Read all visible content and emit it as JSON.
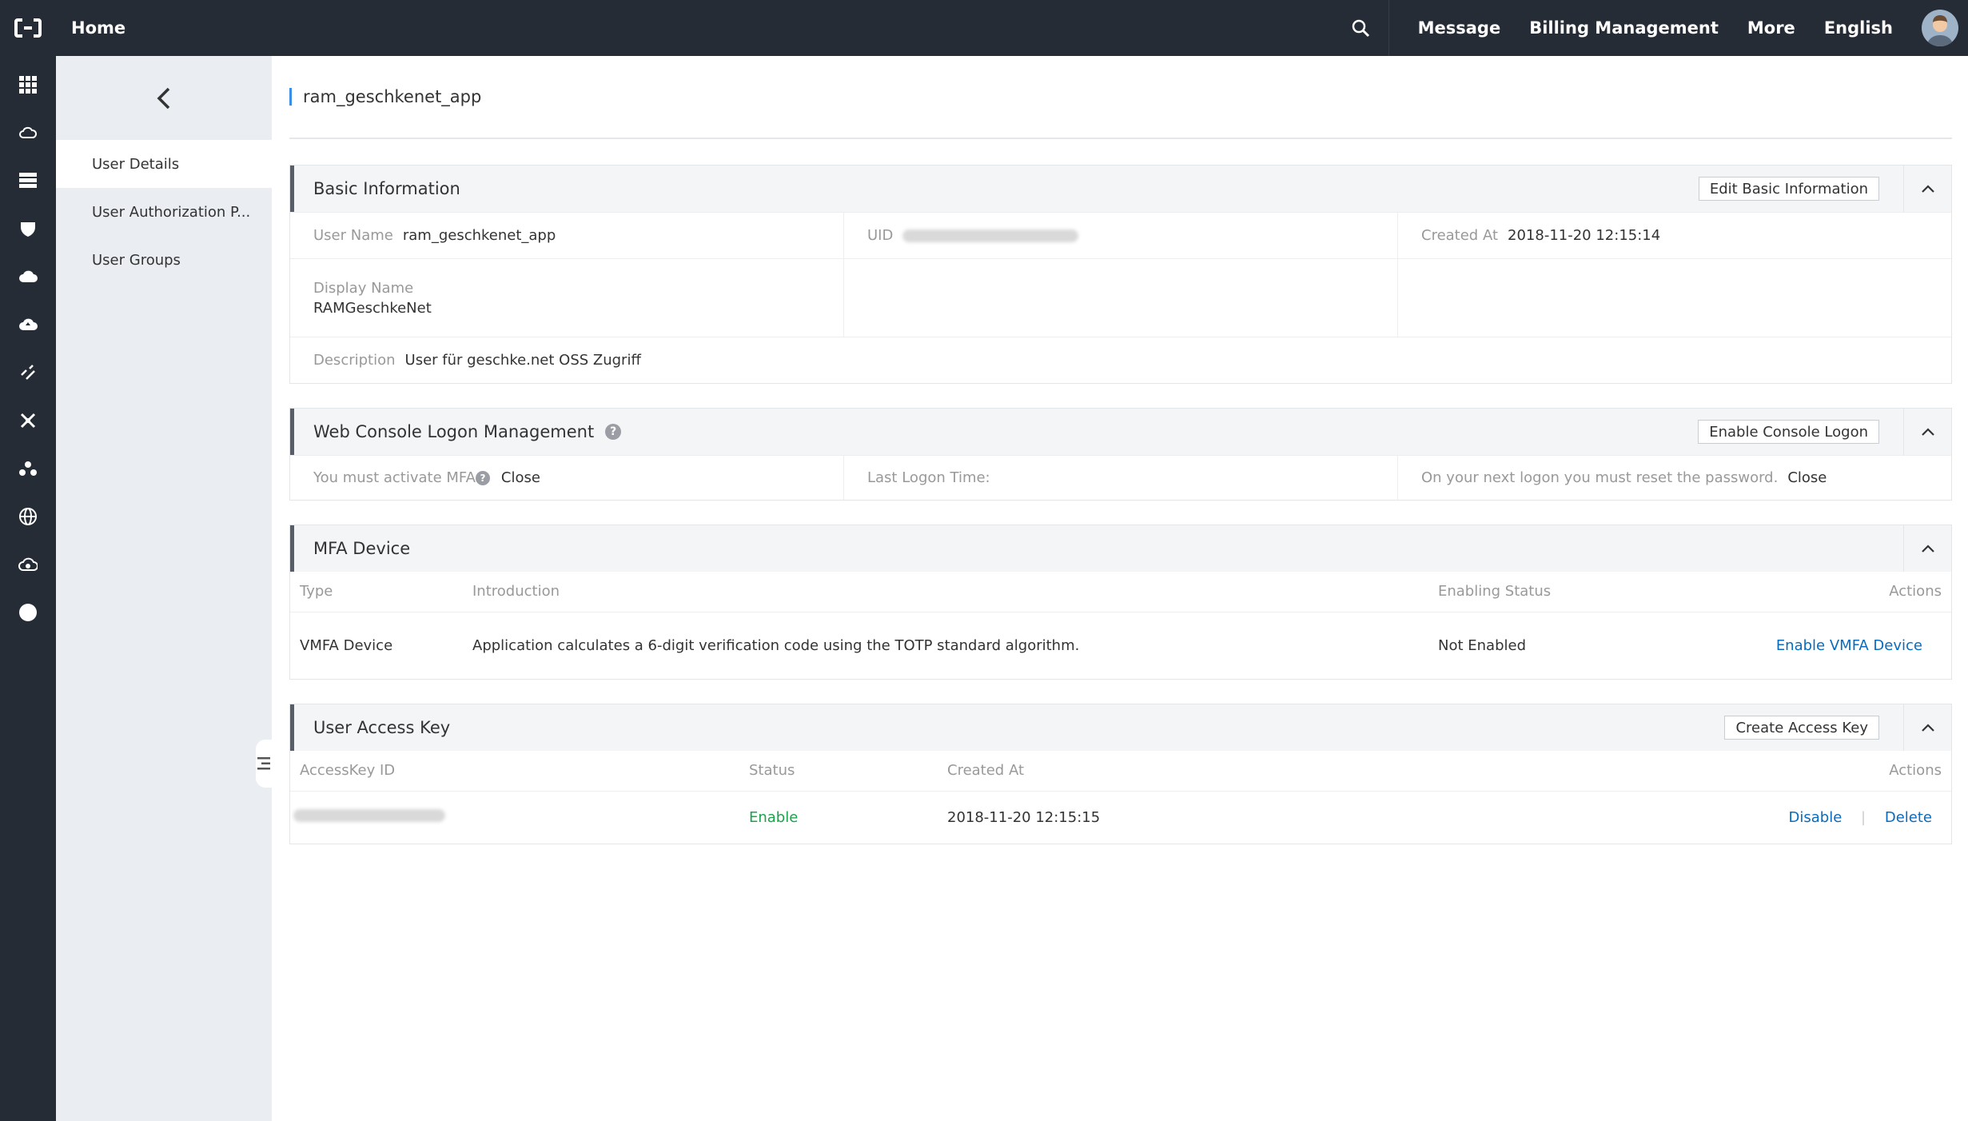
{
  "topbar": {
    "home": "Home",
    "items": [
      "Message",
      "Billing Management",
      "More",
      "English"
    ]
  },
  "subnav": {
    "items": [
      "User Details",
      "User Authorization P...",
      "User Groups"
    ]
  },
  "page_title": "ram_geschkenet_app",
  "basic_info": {
    "title": "Basic Information",
    "edit_button": "Edit Basic Information",
    "user_name_label": "User Name",
    "user_name": "ram_geschkenet_app",
    "uid_label": "UID",
    "created_label": "Created At",
    "created_at": "2018-11-20 12:15:14",
    "display_name_label": "Display Name",
    "display_name": "RAMGeschkeNet",
    "description_label": "Description",
    "description": "User für geschke.net OSS Zugriff"
  },
  "logon": {
    "title": "Web Console Logon Management",
    "enable_button": "Enable Console Logon",
    "mfa_label": "You must activate MFA",
    "mfa_value": "Close",
    "last_logon_label": "Last Logon Time:",
    "reset_label": "On your next logon you must reset the password.",
    "reset_value": "Close"
  },
  "mfa": {
    "title": "MFA Device",
    "headers": [
      "Type",
      "Introduction",
      "Enabling Status",
      "Actions"
    ],
    "row": {
      "type": "VMFA Device",
      "intro": "Application calculates a 6-digit verification code using the TOTP standard algorithm.",
      "status": "Not Enabled",
      "action": "Enable VMFA Device"
    }
  },
  "access_key": {
    "title": "User Access Key",
    "create_button": "Create Access Key",
    "headers": [
      "AccessKey ID",
      "Status",
      "Created At",
      "Actions"
    ],
    "row": {
      "status": "Enable",
      "created_at": "2018-11-20 12:15:15",
      "disable": "Disable",
      "separator": "|",
      "delete": "Delete"
    }
  },
  "colors": {
    "topbar": "#262c36",
    "link": "#0a6bbd",
    "enabled": "#1aa34a",
    "subnav_bg": "#eaedf1"
  }
}
